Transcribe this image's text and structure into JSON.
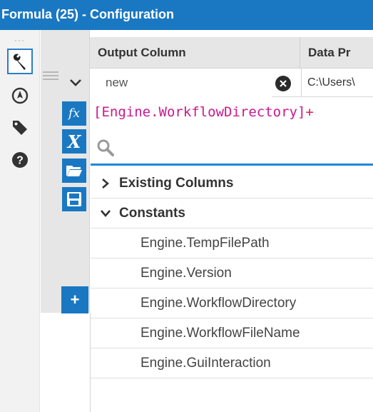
{
  "window": {
    "title": "Formula (25) - Configuration"
  },
  "rail": {
    "icons": [
      "wrench-icon",
      "compass-icon",
      "tag-icon",
      "help-icon"
    ]
  },
  "table": {
    "headers": [
      "Output Column",
      "Data Pr"
    ],
    "row": {
      "output_column_value": "new",
      "output_column_placeholder": "",
      "data_preview": "C:\\Users\\"
    }
  },
  "expression": {
    "text": "[Engine.WorkflowDirectory]",
    "operator": "+"
  },
  "side_tools": [
    "fx-icon",
    "variable-icon",
    "folder-open-icon",
    "save-icon"
  ],
  "search": {
    "value": "",
    "placeholder": ""
  },
  "tree": {
    "groups": [
      {
        "label": "Existing Columns",
        "expanded": false
      },
      {
        "label": "Constants",
        "expanded": true
      }
    ],
    "constants": [
      "Engine.TempFilePath",
      "Engine.Version",
      "Engine.WorkflowDirectory",
      "Engine.WorkflowFileName",
      "Engine.GuiInteraction"
    ]
  },
  "add_button": {
    "label": "+"
  },
  "colors": {
    "accent": "#1a78c2",
    "expression": "#c8188f",
    "panel": "#e6e6e6"
  }
}
